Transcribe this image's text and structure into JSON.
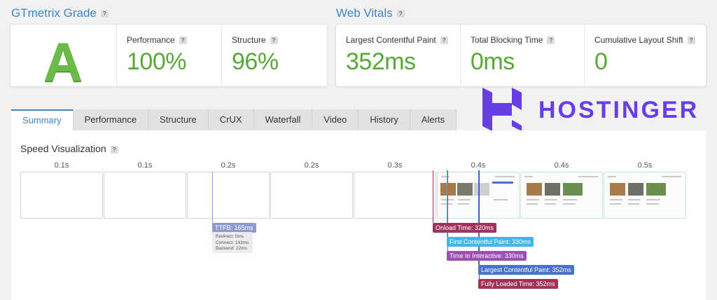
{
  "grade": {
    "title": "GTmetrix Grade",
    "letter": "A",
    "performance_label": "Performance",
    "performance_value": "100%",
    "structure_label": "Structure",
    "structure_value": "96%"
  },
  "web_vitals": {
    "title": "Web Vitals",
    "lcp_label": "Largest Contentful Paint",
    "lcp_value": "352ms",
    "tbt_label": "Total Blocking Time",
    "tbt_value": "0ms",
    "cls_label": "Cumulative Layout Shift",
    "cls_value": "0"
  },
  "tabs": [
    "Summary",
    "Performance",
    "Structure",
    "CrUX",
    "Waterfall",
    "Video",
    "History",
    "Alerts"
  ],
  "active_tab": "Summary",
  "speed_visualization": {
    "title": "Speed Visualization",
    "frame_times": [
      "0.1s",
      "0.1s",
      "0.2s",
      "0.2s",
      "0.3s",
      "0.4s",
      "0.4s",
      "0.5s"
    ],
    "markers": {
      "ttfb": "TTFB: 165ms",
      "ttfb_redirect": "Redirect: 0ms",
      "ttfb_connect": "Connect: 143ms",
      "ttfb_backend": "Backend: 22ms",
      "onload": "Onload Time: 320ms",
      "fcp": "First Contentful Paint: 330ms",
      "tti": "Time to Interactive: 330ms",
      "lcp": "Largest Contentful Paint: 352ms",
      "fully_loaded": "Fully Loaded Time: 352ms"
    }
  },
  "brand": {
    "name": "HOSTINGER",
    "color": "#673de6"
  },
  "colors": {
    "accent": "#3f85c6",
    "good": "#59a73a",
    "ttfb": "#8e9bcf",
    "onload": "#a0335e",
    "fcp": "#41b6e8",
    "tti": "#9b4fb0",
    "lcp": "#4a72cc",
    "fully_loaded": "#a23058"
  }
}
